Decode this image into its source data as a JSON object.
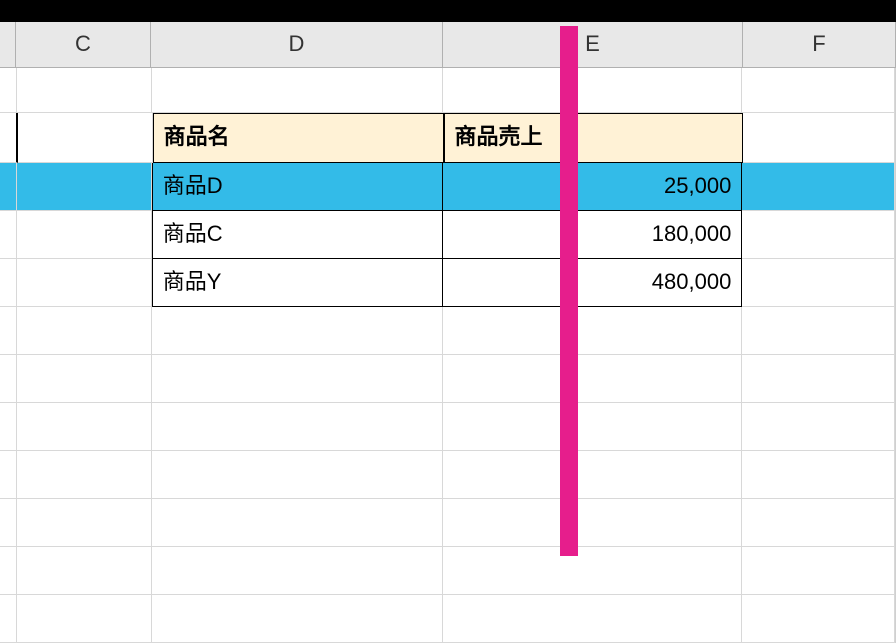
{
  "columns": {
    "c": "C",
    "d": "D",
    "e": "E",
    "f": "F"
  },
  "headers": {
    "name": "商品名",
    "sales": "商品売上"
  },
  "rows": [
    {
      "name": "商品D",
      "sales": "25,000"
    },
    {
      "name": "商品C",
      "sales": "180,000"
    },
    {
      "name": "商品Y",
      "sales": "480,000"
    }
  ],
  "highlight_row_index": 0,
  "overlays": {
    "vertical_stripe_color": "#e61e8c"
  }
}
